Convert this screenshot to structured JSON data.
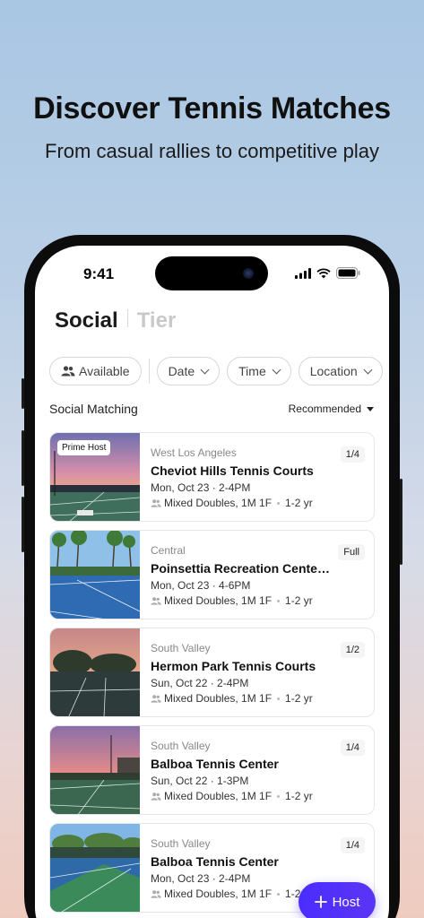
{
  "promo": {
    "headline": "Discover Tennis Matches",
    "subheadline": "From casual rallies to competitive play"
  },
  "status_bar": {
    "time": "9:41"
  },
  "tabs": {
    "active": "Social",
    "inactive": "Tier"
  },
  "filters": {
    "available": "Available",
    "date": "Date",
    "time": "Time",
    "location": "Location"
  },
  "section": {
    "title": "Social Matching",
    "sort": "Recommended"
  },
  "cards": [
    {
      "badge": "Prime Host",
      "region": "West Los Angeles",
      "court": "Cheviot Hills Tennis Courts",
      "when": "Mon, Oct 23 · 2-4PM",
      "format": "Mixed Doubles, 1M 1F",
      "level": "1-2 yr",
      "slots": "1/4"
    },
    {
      "region": "Central",
      "court": "Poinsettia Recreation Center...",
      "when": "Mon, Oct 23 · 4-6PM",
      "format": "Mixed Doubles, 1M 1F",
      "level": "1-2 yr",
      "slots": "Full"
    },
    {
      "region": "South Valley",
      "court": "Hermon Park Tennis Courts",
      "when": "Sun, Oct 22 · 2-4PM",
      "format": "Mixed Doubles, 1M 1F",
      "level": "1-2 yr",
      "slots": "1/2"
    },
    {
      "region": "South Valley",
      "court": "Balboa Tennis Center",
      "when": "Sun, Oct 22 · 1-3PM",
      "format": "Mixed Doubles, 1M 1F",
      "level": "1-2 yr",
      "slots": "1/4"
    },
    {
      "region": "South Valley",
      "court": "Balboa Tennis Center",
      "when": "Mon, Oct 23 · 2-4PM",
      "format": "Mixed Doubles, 1M 1F",
      "level": "1-2 yr",
      "slots": "1/4"
    }
  ],
  "fab": {
    "label": "Host"
  },
  "colors": {
    "accent": "#4a2dff",
    "text": "#111111",
    "muted": "#888888"
  }
}
